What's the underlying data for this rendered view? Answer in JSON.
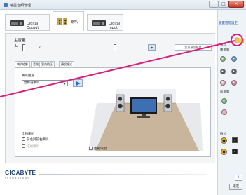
{
  "window": {
    "title": "瑞昱音頻管理",
    "min_glyph": "–",
    "max_glyph": "□",
    "close_glyph": "×"
  },
  "device_tabs": [
    {
      "label": "Digital Output",
      "icon": "speaker-device-icon"
    },
    {
      "label": "喇叭",
      "icon": "speakers-device-icon"
    },
    {
      "label": "Digital Input",
      "icon": "digital-input-icon"
    }
  ],
  "volume": {
    "label": "主音量",
    "left_tag": "L",
    "right_tag": "R",
    "set_default_label": "設爲預設裝置"
  },
  "sub_tabs": [
    "喇叭組態",
    "音效",
    "室內校正",
    "預設格式"
  ],
  "speaker_config": {
    "label": "喇叭組態",
    "selected": "雙聲道喇叭"
  },
  "fullrange": {
    "heading": "全頻喇叭",
    "front": "前左與前右喇叭",
    "surround": "環繞喇叭",
    "front_checked": true,
    "surround_checked": false
  },
  "virtual_surround_label": "虛擬環繞",
  "sidebar": {
    "advanced_link": "裝置進階設定",
    "analog_title": "類比",
    "back_panel": "後面板",
    "front_panel": "前面板",
    "digital_title": "數位",
    "jack_colors": [
      "#6fbf6a",
      "#4a8fd6",
      "#f4a6b4",
      "#555555",
      "#555555",
      "#e07a9a",
      "#b77fc4",
      "#e07a9a",
      "#e07a9a"
    ]
  },
  "footer": {
    "brand": "GIGABYTE",
    "brand_sub": "TECHNOLOGY",
    "info_label": "i",
    "ok_label": "確定"
  }
}
